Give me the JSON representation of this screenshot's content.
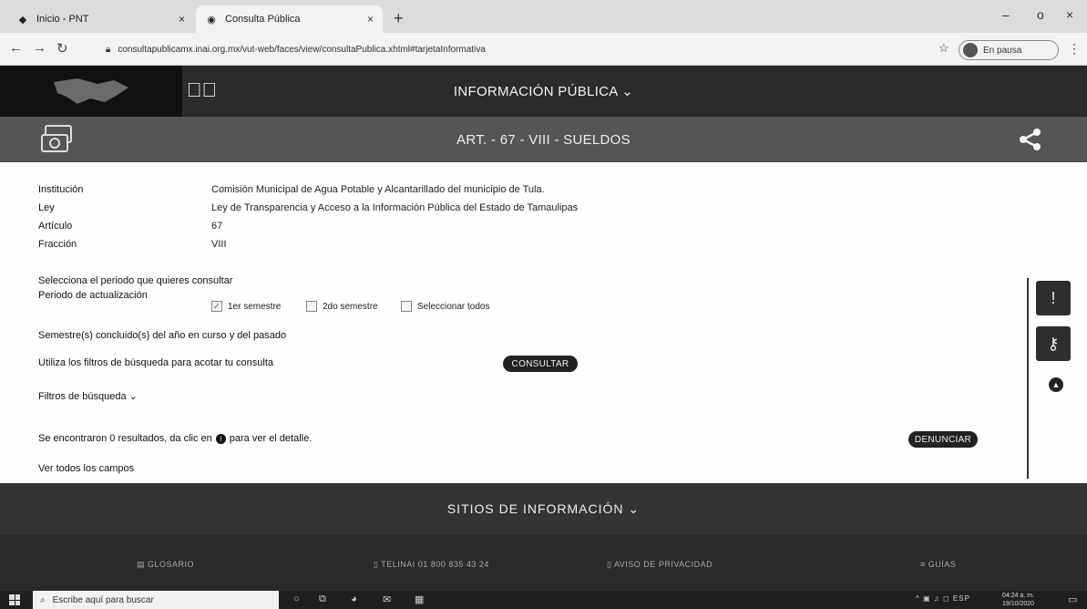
{
  "browser": {
    "tabs": [
      {
        "label": "Inicio - PNT",
        "close": "×"
      },
      {
        "label": "Consulta Pública",
        "close": "×"
      }
    ],
    "new_tab": "+",
    "window_controls": [
      "–",
      "o",
      "×"
    ],
    "url": "consultapublicamx.inai.org.mx/vut-web/faces/view/consultaPublica.xhtml#tarjetaInformativa",
    "profile_label": "En pausa"
  },
  "header": {
    "nav_title": "INFORMACIÓN PÚBLICA ⌄",
    "section_title": "ART. - 67 - VIII - SUELDOS"
  },
  "details": [
    {
      "label": "Institución",
      "value": "Comisión Municipal de Agua Potable y Alcantarillado del municipio de Tula."
    },
    {
      "label": "Ley",
      "value": "Ley de Transparencia y Acceso a la Información Pública del Estado de Tamaulipas"
    },
    {
      "label": "Artículo",
      "value": "67"
    },
    {
      "label": "Fracción",
      "value": "VIII"
    }
  ],
  "period": {
    "prompt": "Selecciona el periodo que quieres consultar",
    "label": "Periodo de actualización",
    "options": [
      {
        "label": "1er semestre",
        "checked": true
      },
      {
        "label": "2do semestre",
        "checked": false
      },
      {
        "label": "Seleccionar todos",
        "checked": false
      }
    ]
  },
  "semesters_text": "Semestre(s) concluido(s) del año en curso y del pasado",
  "filters_text": "Utiliza los filtros de búsqueda para acotar tu consulta",
  "consult_button": "CONSULTAR",
  "filters_toggle": "Filtros de búsqueda ⌄",
  "results_text_a": "Se encontraron 0 resultados, da clic en",
  "results_text_b": "para ver el detalle.",
  "denounce_button": "DENUNCIAR",
  "view_all_fields": "Ver todos los campos",
  "footer": {
    "sites_title": "SITIOS DE INFORMACIÓN ⌄",
    "links": [
      "GLOSARIO",
      "TELINAI 01 800 835 43 24",
      "AVISO DE PRIVACIDAD",
      "GUÍAS"
    ]
  },
  "taskbar": {
    "search_placeholder": "Escribe aquí para buscar",
    "language": "ESP",
    "time": "04:24 a. m.",
    "date": "19/10/2020"
  },
  "colors": {
    "header_dark": "#2b2b2b",
    "header_mid": "#555555",
    "footer": "#333333"
  }
}
